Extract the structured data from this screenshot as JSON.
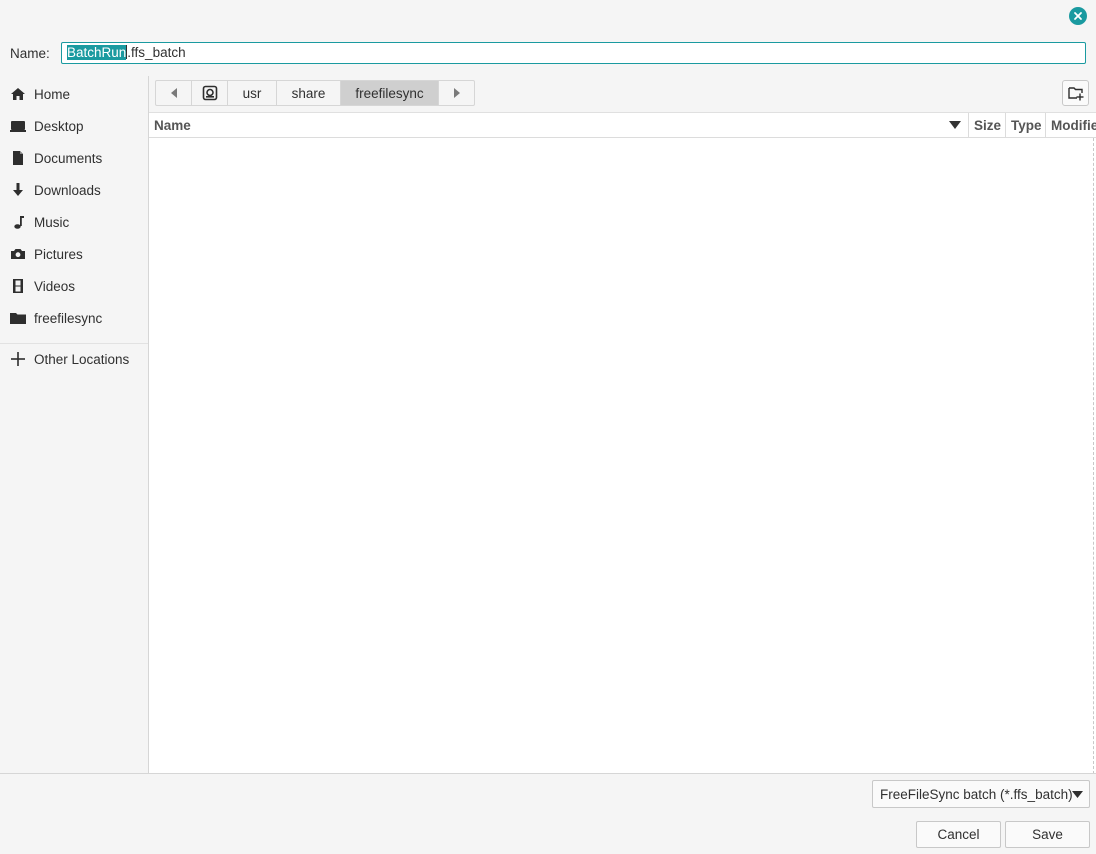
{
  "dialog": {
    "name_label": "Name:",
    "filename_selected": "BatchRun",
    "filename_rest": ".ffs_batch",
    "close_icon": "close-icon",
    "accent_color": "#1a9aa0"
  },
  "sidebar": {
    "items": [
      {
        "label": "Home",
        "icon": "home-icon"
      },
      {
        "label": "Desktop",
        "icon": "desktop-icon"
      },
      {
        "label": "Documents",
        "icon": "document-icon"
      },
      {
        "label": "Downloads",
        "icon": "download-icon"
      },
      {
        "label": "Music",
        "icon": "music-icon"
      },
      {
        "label": "Pictures",
        "icon": "camera-icon"
      },
      {
        "label": "Videos",
        "icon": "film-icon"
      },
      {
        "label": "freefilesync",
        "icon": "folder-icon"
      },
      {
        "label": "Other Locations",
        "icon": "plus-icon"
      }
    ]
  },
  "pathbar": {
    "segments": [
      "usr",
      "share",
      "freefilesync"
    ],
    "active": "freefilesync"
  },
  "filelist": {
    "columns": [
      "Name",
      "Size",
      "Type",
      "Modified"
    ]
  },
  "footer": {
    "filter": "FreeFileSync batch (*.ffs_batch)",
    "cancel_label": "Cancel",
    "save_label": "Save"
  }
}
